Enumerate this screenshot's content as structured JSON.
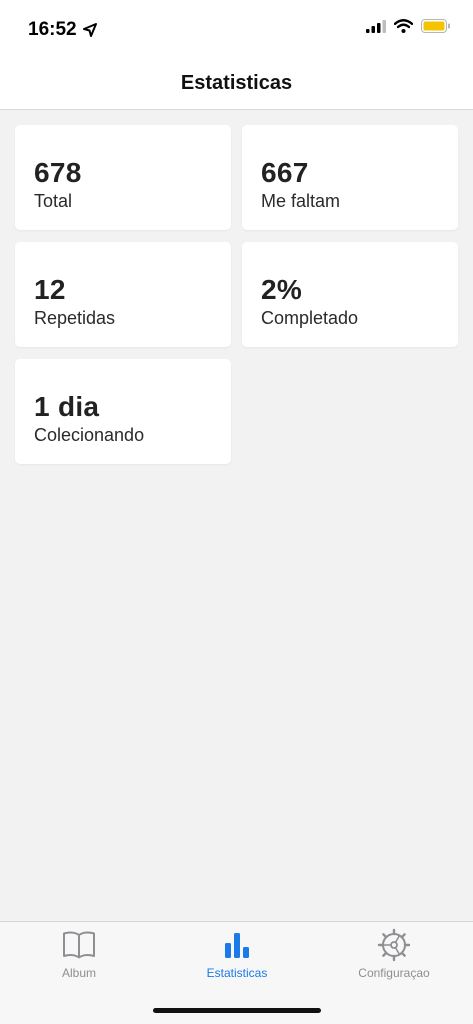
{
  "status_bar": {
    "time": "16:52",
    "icons": [
      "location-arrow-icon",
      "signal-icon",
      "wifi-icon",
      "battery-icon"
    ],
    "battery_color": "#f5c400"
  },
  "header": {
    "title": "Estatisticas"
  },
  "stats": [
    {
      "value": "678",
      "label": "Total"
    },
    {
      "value": "667",
      "label": "Me faltam"
    },
    {
      "value": "12",
      "label": "Repetidas"
    },
    {
      "value": "2%",
      "label": "Completado"
    },
    {
      "value": "1 dia",
      "label": "Colecionando"
    }
  ],
  "tab_bar": {
    "active_color": "#1a7ae8",
    "inactive_color": "#8e8e93",
    "tabs": [
      {
        "label": "Album",
        "icon": "book-icon",
        "active": false
      },
      {
        "label": "Estatisticas",
        "icon": "bar-chart-icon",
        "active": true
      },
      {
        "label": "Configuraçao",
        "icon": "gear-icon",
        "active": false
      }
    ]
  }
}
